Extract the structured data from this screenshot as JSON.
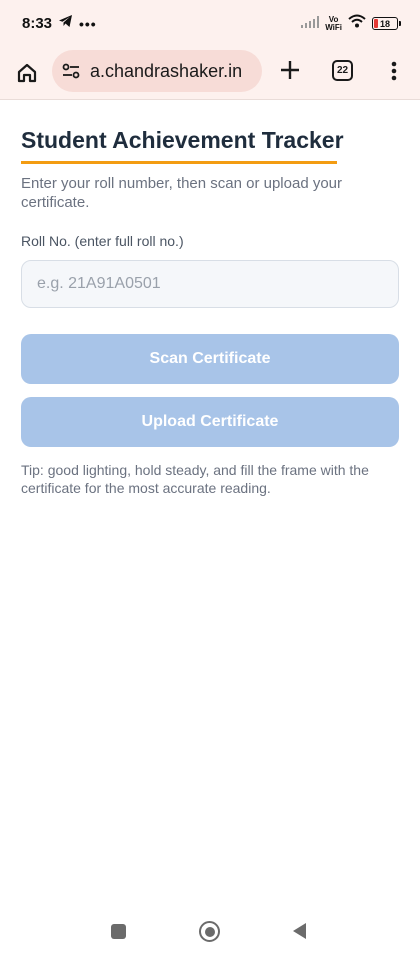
{
  "status_bar": {
    "time": "8:33",
    "overflow_dots": "•••",
    "vowifi_line1": "Vo",
    "vowifi_line2": "WiFi",
    "battery_level": "18",
    "icons": [
      "telegram-icon",
      "signal-icon",
      "wifi-icon",
      "battery-icon"
    ]
  },
  "browser": {
    "url": "a.chandrashaker.in",
    "tab_count": "22",
    "icons": [
      "home-icon",
      "site-settings-icon",
      "new-tab-icon",
      "tabs-icon",
      "more-menu-icon"
    ]
  },
  "page": {
    "title": "Student Achievement Tracker",
    "intro": "Enter your roll number, then scan or upload your certificate.",
    "roll_label": "Roll No. (enter full roll no.)",
    "roll_placeholder": "e.g. 21A91A0501",
    "roll_value": "",
    "scan_button": "Scan Certificate",
    "upload_button": "Upload Certificate",
    "tip": "Tip: good lighting, hold steady, and fill the frame with the certificate for the most accurate reading."
  },
  "colors": {
    "accent_underline": "#f39c12",
    "button_disabled": "#a8c4e8",
    "browser_chrome": "#fdf1ee",
    "url_pill": "#f7dcd7"
  },
  "nav_bar": {
    "icons": [
      "recent-apps-icon",
      "home-circle-icon",
      "back-icon"
    ]
  }
}
